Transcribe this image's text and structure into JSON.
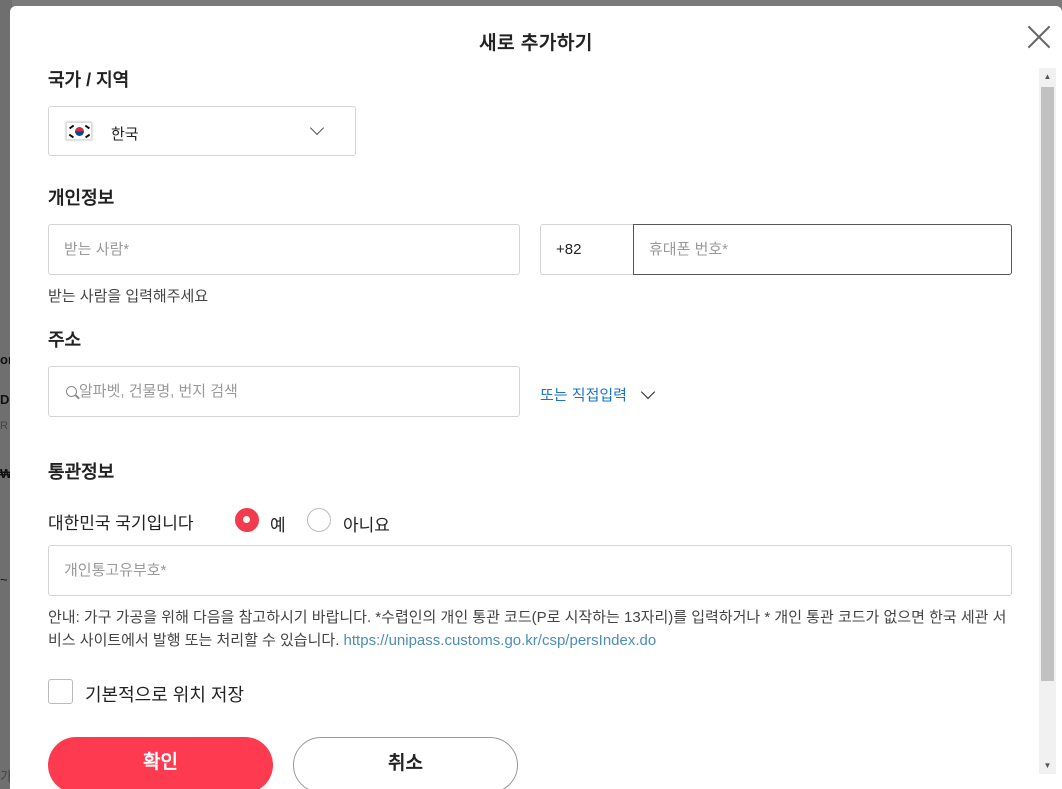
{
  "background_page": {
    "fragments": [
      "or",
      "D",
      "R",
      "₩",
      "~",
      "가"
    ]
  },
  "modal": {
    "title": "새로 추가하기"
  },
  "country": {
    "section_label": "국가 / 지역",
    "selected": "한국"
  },
  "personal": {
    "section_label": "개인정보",
    "recipient_placeholder": "받는 사람*",
    "phone_prefix": "+82",
    "phone_placeholder": "휴대폰 번호*",
    "recipient_hint": "받는 사람을 입력해주세요"
  },
  "address": {
    "section_label": "주소",
    "search_placeholder": "알파벳, 건물명, 번지 검색",
    "manual_link": "또는 직접입력"
  },
  "customs": {
    "section_label": "통관정보",
    "nationality_question": "대한민국 국기입니다",
    "yes_label": "예",
    "no_label": "아니요",
    "selected": "예",
    "customs_code_placeholder": "개인통고유부호*",
    "notice_text": "안내: 가구 가공을 위해 다음을 참고하시기 바랍니다. *수렵인의 개인 통관 코드(P로 시작하는 13자리)를 입력하거나 * 개인 통관 코드가 없으면 한국 세관 서비스 사이트에서 발행 또는 처리할 수 있습니다. ",
    "notice_link": "https://unipass.customs.go.kr/csp/persIndex.do"
  },
  "save_default": {
    "label": "기본적으로 위치 저장",
    "checked": false
  },
  "actions": {
    "confirm_label": "확인",
    "cancel_label": "취소"
  },
  "colors": {
    "accent": "#fd3a4f",
    "link": "#1a73c9",
    "overlay": "#7a7a7a"
  }
}
